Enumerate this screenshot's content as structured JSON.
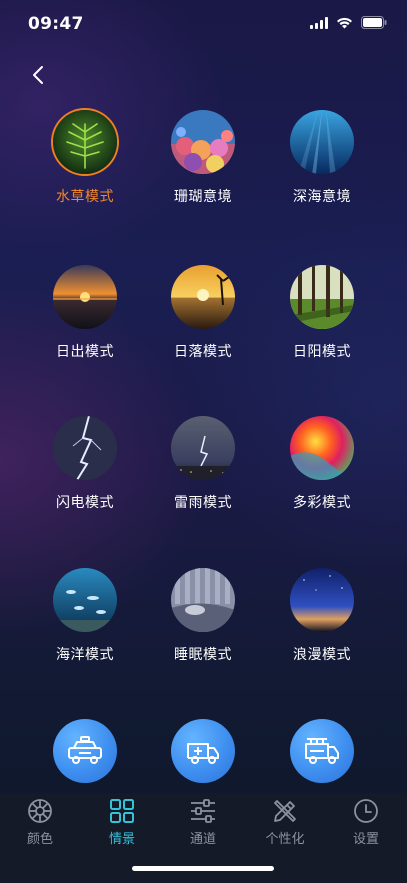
{
  "status_bar": {
    "time": "09:47"
  },
  "nav": {
    "back_icon": "chevron-left-icon"
  },
  "scenes": [
    {
      "label": "水草模式",
      "selected": true,
      "image": "aquatic-plant"
    },
    {
      "label": "珊瑚意境",
      "selected": false,
      "image": "coral-reef"
    },
    {
      "label": "深海意境",
      "selected": false,
      "image": "deep-sea"
    },
    {
      "label": "日出模式",
      "selected": false,
      "image": "sunrise"
    },
    {
      "label": "日落模式",
      "selected": false,
      "image": "sunset"
    },
    {
      "label": "日阳模式",
      "selected": false,
      "image": "sunlit-forest"
    },
    {
      "label": "闪电模式",
      "selected": false,
      "image": "lightning"
    },
    {
      "label": "雷雨模式",
      "selected": false,
      "image": "thunderstorm"
    },
    {
      "label": "多彩模式",
      "selected": false,
      "image": "colorful"
    },
    {
      "label": "海洋模式",
      "selected": false,
      "image": "ocean"
    },
    {
      "label": "睡眠模式",
      "selected": false,
      "image": "sleep"
    },
    {
      "label": "浪漫模式",
      "selected": false,
      "image": "romantic"
    }
  ],
  "quick_actions": [
    {
      "icon": "police-car-icon"
    },
    {
      "icon": "ambulance-icon"
    },
    {
      "icon": "fire-truck-icon"
    }
  ],
  "tabbar": {
    "active": 1,
    "items": [
      {
        "label": "颜色",
        "icon": "color-wheel-icon"
      },
      {
        "label": "情景",
        "icon": "grid-icon"
      },
      {
        "label": "通道",
        "icon": "sliders-icon"
      },
      {
        "label": "个性化",
        "icon": "pencil-ruler-icon"
      },
      {
        "label": "设置",
        "icon": "clock-icon"
      }
    ]
  },
  "colors": {
    "accent_orange": "#f0872a",
    "accent_cyan": "#35c3d8",
    "tab_inactive": "#8d92a0",
    "fab_blue": "#3f8ff0"
  }
}
